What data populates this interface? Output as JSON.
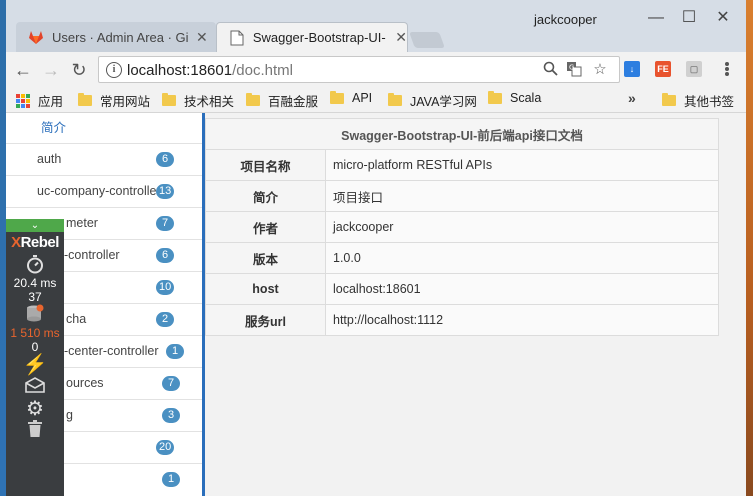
{
  "browser": {
    "tabs": [
      {
        "title": "Users · Admin Area · Gi",
        "favicon": "gitlab-icon",
        "active": false
      },
      {
        "title": "Swagger-Bootstrap-UI-",
        "favicon": "page-icon",
        "active": true
      }
    ],
    "user_name": "jackcooper",
    "window_controls": {
      "minimize": "—",
      "maximize": "☐",
      "close": "✕"
    },
    "address": {
      "host": "localhost:18601",
      "path": "/doc.html"
    },
    "bookmarks": [
      {
        "label": "应用",
        "icon": "apps-icon"
      },
      {
        "label": "常用网站",
        "icon": "folder-icon"
      },
      {
        "label": "技术相关",
        "icon": "folder-icon"
      },
      {
        "label": "百融金服",
        "icon": "folder-icon"
      },
      {
        "label": "API",
        "icon": "folder-icon"
      },
      {
        "label": "JAVA学习网",
        "icon": "folder-icon"
      },
      {
        "label": "Scala",
        "icon": "folder-icon"
      }
    ],
    "bookmarks_overflow": "»",
    "other_bookmarks": "其他书签",
    "extensions": [
      {
        "name": "download-extension",
        "label": "↓",
        "color": "#2d7ee0"
      },
      {
        "name": "fe-extension",
        "label": "FE",
        "color": "#e8532e"
      },
      {
        "name": "extension-3",
        "label": "▢",
        "color": "#9a9a9a"
      }
    ]
  },
  "sidebar": {
    "intro": "简介",
    "items": [
      {
        "label": "auth",
        "count": "6"
      },
      {
        "label": "uc-company-controller",
        "count": "13"
      },
      {
        "label": "meter",
        "count": "7"
      },
      {
        "label": "-controller",
        "count": "6"
      },
      {
        "label": "",
        "count": "10"
      },
      {
        "label": "cha",
        "count": "2"
      },
      {
        "label": "-center-controller",
        "count": "1"
      },
      {
        "label": "ources",
        "count": "7"
      },
      {
        "label": "g",
        "count": "3"
      },
      {
        "label": "",
        "count": "20"
      },
      {
        "label": "",
        "count": "1"
      }
    ]
  },
  "doc": {
    "title": "Swagger-Bootstrap-UI-前后端api接口文档",
    "rows": [
      {
        "key": "项目名称",
        "value": "micro-platform RESTful APIs"
      },
      {
        "key": "简介",
        "value": "项目接口"
      },
      {
        "key": "作者",
        "value": "jackcooper"
      },
      {
        "key": "版本",
        "value": "1.0.0"
      },
      {
        "key": "host",
        "value": "localhost:18601"
      },
      {
        "key": "服务url",
        "value": "http://localhost:1112"
      }
    ]
  },
  "xrebel": {
    "brand_x": "X",
    "brand_rest": "Rebel",
    "time": "20.4 ms",
    "db_count": "37",
    "db_time": "1 510 ms",
    "io_count": "0",
    "colors": {
      "brand_accent": "#e8652e",
      "toggle": "#4fa84a",
      "panel": "#3a3d40"
    }
  },
  "colors": {
    "accent": "#2a6ebb",
    "badge": "#4a90c2"
  }
}
